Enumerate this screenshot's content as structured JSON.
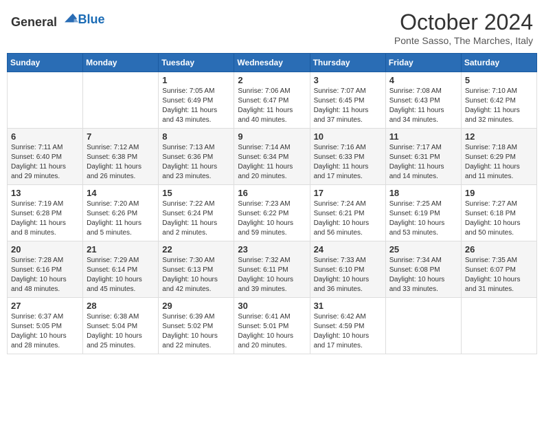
{
  "logo": {
    "general": "General",
    "blue": "Blue"
  },
  "title": "October 2024",
  "location": "Ponte Sasso, The Marches, Italy",
  "weekdays": [
    "Sunday",
    "Monday",
    "Tuesday",
    "Wednesday",
    "Thursday",
    "Friday",
    "Saturday"
  ],
  "weeks": [
    [
      null,
      null,
      {
        "day": 1,
        "sunrise": "7:05 AM",
        "sunset": "6:49 PM",
        "daylight": "11 hours and 43 minutes."
      },
      {
        "day": 2,
        "sunrise": "7:06 AM",
        "sunset": "6:47 PM",
        "daylight": "11 hours and 40 minutes."
      },
      {
        "day": 3,
        "sunrise": "7:07 AM",
        "sunset": "6:45 PM",
        "daylight": "11 hours and 37 minutes."
      },
      {
        "day": 4,
        "sunrise": "7:08 AM",
        "sunset": "6:43 PM",
        "daylight": "11 hours and 34 minutes."
      },
      {
        "day": 5,
        "sunrise": "7:10 AM",
        "sunset": "6:42 PM",
        "daylight": "11 hours and 32 minutes."
      }
    ],
    [
      {
        "day": 6,
        "sunrise": "7:11 AM",
        "sunset": "6:40 PM",
        "daylight": "11 hours and 29 minutes."
      },
      {
        "day": 7,
        "sunrise": "7:12 AM",
        "sunset": "6:38 PM",
        "daylight": "11 hours and 26 minutes."
      },
      {
        "day": 8,
        "sunrise": "7:13 AM",
        "sunset": "6:36 PM",
        "daylight": "11 hours and 23 minutes."
      },
      {
        "day": 9,
        "sunrise": "7:14 AM",
        "sunset": "6:34 PM",
        "daylight": "11 hours and 20 minutes."
      },
      {
        "day": 10,
        "sunrise": "7:16 AM",
        "sunset": "6:33 PM",
        "daylight": "11 hours and 17 minutes."
      },
      {
        "day": 11,
        "sunrise": "7:17 AM",
        "sunset": "6:31 PM",
        "daylight": "11 hours and 14 minutes."
      },
      {
        "day": 12,
        "sunrise": "7:18 AM",
        "sunset": "6:29 PM",
        "daylight": "11 hours and 11 minutes."
      }
    ],
    [
      {
        "day": 13,
        "sunrise": "7:19 AM",
        "sunset": "6:28 PM",
        "daylight": "11 hours and 8 minutes."
      },
      {
        "day": 14,
        "sunrise": "7:20 AM",
        "sunset": "6:26 PM",
        "daylight": "11 hours and 5 minutes."
      },
      {
        "day": 15,
        "sunrise": "7:22 AM",
        "sunset": "6:24 PM",
        "daylight": "11 hours and 2 minutes."
      },
      {
        "day": 16,
        "sunrise": "7:23 AM",
        "sunset": "6:22 PM",
        "daylight": "10 hours and 59 minutes."
      },
      {
        "day": 17,
        "sunrise": "7:24 AM",
        "sunset": "6:21 PM",
        "daylight": "10 hours and 56 minutes."
      },
      {
        "day": 18,
        "sunrise": "7:25 AM",
        "sunset": "6:19 PM",
        "daylight": "10 hours and 53 minutes."
      },
      {
        "day": 19,
        "sunrise": "7:27 AM",
        "sunset": "6:18 PM",
        "daylight": "10 hours and 50 minutes."
      }
    ],
    [
      {
        "day": 20,
        "sunrise": "7:28 AM",
        "sunset": "6:16 PM",
        "daylight": "10 hours and 48 minutes."
      },
      {
        "day": 21,
        "sunrise": "7:29 AM",
        "sunset": "6:14 PM",
        "daylight": "10 hours and 45 minutes."
      },
      {
        "day": 22,
        "sunrise": "7:30 AM",
        "sunset": "6:13 PM",
        "daylight": "10 hours and 42 minutes."
      },
      {
        "day": 23,
        "sunrise": "7:32 AM",
        "sunset": "6:11 PM",
        "daylight": "10 hours and 39 minutes."
      },
      {
        "day": 24,
        "sunrise": "7:33 AM",
        "sunset": "6:10 PM",
        "daylight": "10 hours and 36 minutes."
      },
      {
        "day": 25,
        "sunrise": "7:34 AM",
        "sunset": "6:08 PM",
        "daylight": "10 hours and 33 minutes."
      },
      {
        "day": 26,
        "sunrise": "7:35 AM",
        "sunset": "6:07 PM",
        "daylight": "10 hours and 31 minutes."
      }
    ],
    [
      {
        "day": 27,
        "sunrise": "6:37 AM",
        "sunset": "5:05 PM",
        "daylight": "10 hours and 28 minutes."
      },
      {
        "day": 28,
        "sunrise": "6:38 AM",
        "sunset": "5:04 PM",
        "daylight": "10 hours and 25 minutes."
      },
      {
        "day": 29,
        "sunrise": "6:39 AM",
        "sunset": "5:02 PM",
        "daylight": "10 hours and 22 minutes."
      },
      {
        "day": 30,
        "sunrise": "6:41 AM",
        "sunset": "5:01 PM",
        "daylight": "10 hours and 20 minutes."
      },
      {
        "day": 31,
        "sunrise": "6:42 AM",
        "sunset": "4:59 PM",
        "daylight": "10 hours and 17 minutes."
      },
      null,
      null
    ]
  ],
  "labels": {
    "sunrise": "Sunrise:",
    "sunset": "Sunset:",
    "daylight": "Daylight:"
  }
}
